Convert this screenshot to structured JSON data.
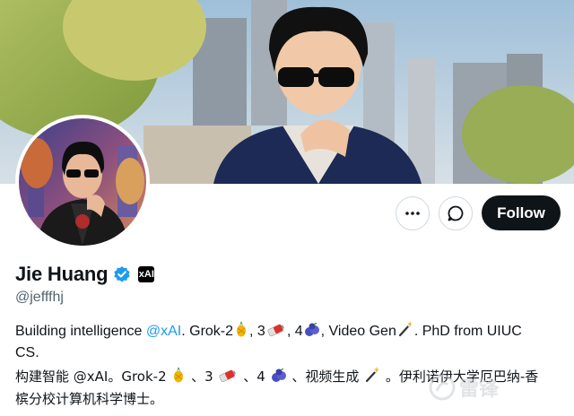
{
  "profile": {
    "display_name": "Jie Huang",
    "handle": "@jefffhj",
    "verified": true,
    "affiliation_badge": "xAI"
  },
  "actions": {
    "more_icon": "more-horizontal-icon",
    "message_icon": "message-bubble-icon",
    "follow_label": "Follow"
  },
  "bio_en": {
    "part1": "Building intelligence ",
    "mention": "@xAI",
    "part2": ". Grok-2",
    "part3": ", 3",
    "part4": ", 4",
    "part5": ", Video Gen",
    "part6": ". PhD from UIUC CS."
  },
  "bio_zh": {
    "part1": "构建智能 @xAI。Grok-2 ",
    "part2": " 、3 ",
    "part3": " 、4 ",
    "part4": " 、视频生成 ",
    "part5": " 。伊利诺伊大学厄巴纳-香槟分校计算机科学博士。"
  },
  "watermark": {
    "text": "雷锋"
  },
  "colors": {
    "accent": "#1d9bf0",
    "follow_bg": "#0f1419",
    "secondary_text": "#536471",
    "border": "#cfd9de"
  }
}
